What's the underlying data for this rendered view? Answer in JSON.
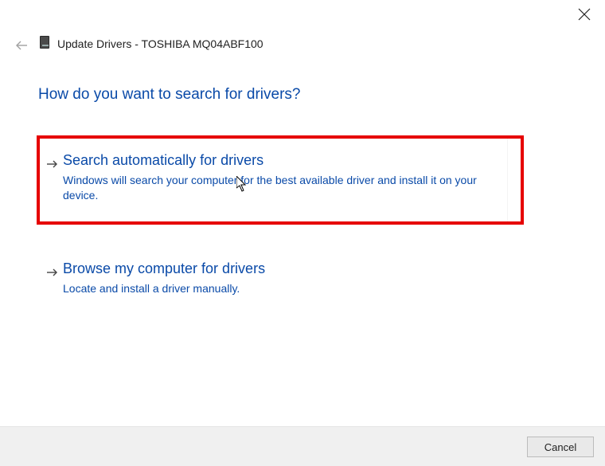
{
  "window": {
    "title": "Update Drivers - TOSHIBA MQ04ABF100"
  },
  "heading": "How do you want to search for drivers?",
  "options": {
    "auto": {
      "title": "Search automatically for drivers",
      "desc": "Windows will search your computer for the best available driver and install it on your device."
    },
    "browse": {
      "title": "Browse my computer for drivers",
      "desc": "Locate and install a driver manually."
    }
  },
  "buttons": {
    "cancel": "Cancel"
  }
}
